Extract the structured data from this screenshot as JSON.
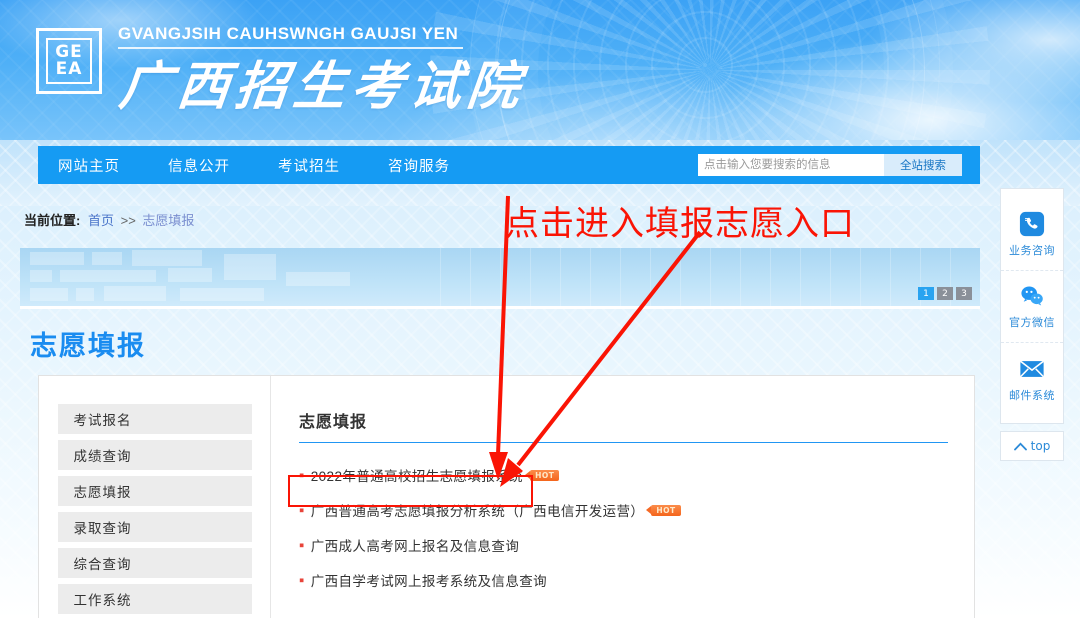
{
  "header": {
    "logo_letters": [
      "GE",
      "EA"
    ],
    "brand_zhuang": "GVANGJSIH CAUHSWNGH GAUJSI YEN",
    "brand_cn": "广西招生考试院"
  },
  "nav": {
    "items": [
      {
        "label": "网站主页"
      },
      {
        "label": "信息公开"
      },
      {
        "label": "考试招生"
      },
      {
        "label": "咨询服务"
      }
    ]
  },
  "search": {
    "value": "",
    "placeholder": "点击输入您要搜索的信息",
    "button_label": "全站搜索"
  },
  "breadcrumb": {
    "label": "当前位置:",
    "home": "首页",
    "separator": ">>",
    "current": "志愿填报"
  },
  "carousel": {
    "dots": [
      "1",
      "2",
      "3"
    ],
    "active_index": 0
  },
  "page": {
    "title": "志愿填报"
  },
  "sidebar": {
    "items": [
      {
        "label": "考试报名"
      },
      {
        "label": "成绩查询"
      },
      {
        "label": "志愿填报"
      },
      {
        "label": "录取查询"
      },
      {
        "label": "综合查询"
      },
      {
        "label": "工作系统"
      }
    ]
  },
  "main": {
    "section_title": "志愿填报",
    "links": [
      {
        "label": "2022年普通高校招生志愿填报系统",
        "hot": true,
        "badge": "HOT"
      },
      {
        "label": "广西普通高考志愿填报分析系统（广西电信开发运营）",
        "hot": true,
        "badge": "HOT"
      },
      {
        "label": "广西成人高考网上报名及信息查询",
        "hot": false
      },
      {
        "label": "广西自学考试网上报考系统及信息查询",
        "hot": false
      }
    ]
  },
  "float_panel": {
    "items": [
      {
        "label": "业务咨询",
        "icon": "phone-icon"
      },
      {
        "label": "官方微信",
        "icon": "wechat-icon"
      },
      {
        "label": "邮件系统",
        "icon": "mail-icon"
      }
    ],
    "top_label": "top"
  },
  "annotation": {
    "text": "点击进入填报志愿入口",
    "color": "#fa1405"
  },
  "colors": {
    "brand_blue": "#159bf3",
    "accent_blue": "#1a8cf0",
    "hot_orange": "#f4651c",
    "annotation_red": "#fa1405"
  }
}
